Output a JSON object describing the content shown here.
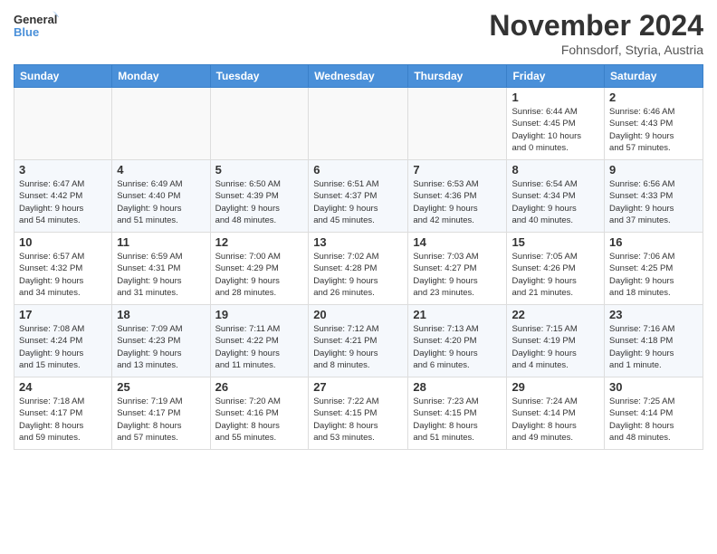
{
  "logo": {
    "line1": "General",
    "line2": "Blue"
  },
  "title": "November 2024",
  "location": "Fohnsdorf, Styria, Austria",
  "weekdays": [
    "Sunday",
    "Monday",
    "Tuesday",
    "Wednesday",
    "Thursday",
    "Friday",
    "Saturday"
  ],
  "weeks": [
    [
      {
        "day": "",
        "info": ""
      },
      {
        "day": "",
        "info": ""
      },
      {
        "day": "",
        "info": ""
      },
      {
        "day": "",
        "info": ""
      },
      {
        "day": "",
        "info": ""
      },
      {
        "day": "1",
        "info": "Sunrise: 6:44 AM\nSunset: 4:45 PM\nDaylight: 10 hours\nand 0 minutes."
      },
      {
        "day": "2",
        "info": "Sunrise: 6:46 AM\nSunset: 4:43 PM\nDaylight: 9 hours\nand 57 minutes."
      }
    ],
    [
      {
        "day": "3",
        "info": "Sunrise: 6:47 AM\nSunset: 4:42 PM\nDaylight: 9 hours\nand 54 minutes."
      },
      {
        "day": "4",
        "info": "Sunrise: 6:49 AM\nSunset: 4:40 PM\nDaylight: 9 hours\nand 51 minutes."
      },
      {
        "day": "5",
        "info": "Sunrise: 6:50 AM\nSunset: 4:39 PM\nDaylight: 9 hours\nand 48 minutes."
      },
      {
        "day": "6",
        "info": "Sunrise: 6:51 AM\nSunset: 4:37 PM\nDaylight: 9 hours\nand 45 minutes."
      },
      {
        "day": "7",
        "info": "Sunrise: 6:53 AM\nSunset: 4:36 PM\nDaylight: 9 hours\nand 42 minutes."
      },
      {
        "day": "8",
        "info": "Sunrise: 6:54 AM\nSunset: 4:34 PM\nDaylight: 9 hours\nand 40 minutes."
      },
      {
        "day": "9",
        "info": "Sunrise: 6:56 AM\nSunset: 4:33 PM\nDaylight: 9 hours\nand 37 minutes."
      }
    ],
    [
      {
        "day": "10",
        "info": "Sunrise: 6:57 AM\nSunset: 4:32 PM\nDaylight: 9 hours\nand 34 minutes."
      },
      {
        "day": "11",
        "info": "Sunrise: 6:59 AM\nSunset: 4:31 PM\nDaylight: 9 hours\nand 31 minutes."
      },
      {
        "day": "12",
        "info": "Sunrise: 7:00 AM\nSunset: 4:29 PM\nDaylight: 9 hours\nand 28 minutes."
      },
      {
        "day": "13",
        "info": "Sunrise: 7:02 AM\nSunset: 4:28 PM\nDaylight: 9 hours\nand 26 minutes."
      },
      {
        "day": "14",
        "info": "Sunrise: 7:03 AM\nSunset: 4:27 PM\nDaylight: 9 hours\nand 23 minutes."
      },
      {
        "day": "15",
        "info": "Sunrise: 7:05 AM\nSunset: 4:26 PM\nDaylight: 9 hours\nand 21 minutes."
      },
      {
        "day": "16",
        "info": "Sunrise: 7:06 AM\nSunset: 4:25 PM\nDaylight: 9 hours\nand 18 minutes."
      }
    ],
    [
      {
        "day": "17",
        "info": "Sunrise: 7:08 AM\nSunset: 4:24 PM\nDaylight: 9 hours\nand 15 minutes."
      },
      {
        "day": "18",
        "info": "Sunrise: 7:09 AM\nSunset: 4:23 PM\nDaylight: 9 hours\nand 13 minutes."
      },
      {
        "day": "19",
        "info": "Sunrise: 7:11 AM\nSunset: 4:22 PM\nDaylight: 9 hours\nand 11 minutes."
      },
      {
        "day": "20",
        "info": "Sunrise: 7:12 AM\nSunset: 4:21 PM\nDaylight: 9 hours\nand 8 minutes."
      },
      {
        "day": "21",
        "info": "Sunrise: 7:13 AM\nSunset: 4:20 PM\nDaylight: 9 hours\nand 6 minutes."
      },
      {
        "day": "22",
        "info": "Sunrise: 7:15 AM\nSunset: 4:19 PM\nDaylight: 9 hours\nand 4 minutes."
      },
      {
        "day": "23",
        "info": "Sunrise: 7:16 AM\nSunset: 4:18 PM\nDaylight: 9 hours\nand 1 minute."
      }
    ],
    [
      {
        "day": "24",
        "info": "Sunrise: 7:18 AM\nSunset: 4:17 PM\nDaylight: 8 hours\nand 59 minutes."
      },
      {
        "day": "25",
        "info": "Sunrise: 7:19 AM\nSunset: 4:17 PM\nDaylight: 8 hours\nand 57 minutes."
      },
      {
        "day": "26",
        "info": "Sunrise: 7:20 AM\nSunset: 4:16 PM\nDaylight: 8 hours\nand 55 minutes."
      },
      {
        "day": "27",
        "info": "Sunrise: 7:22 AM\nSunset: 4:15 PM\nDaylight: 8 hours\nand 53 minutes."
      },
      {
        "day": "28",
        "info": "Sunrise: 7:23 AM\nSunset: 4:15 PM\nDaylight: 8 hours\nand 51 minutes."
      },
      {
        "day": "29",
        "info": "Sunrise: 7:24 AM\nSunset: 4:14 PM\nDaylight: 8 hours\nand 49 minutes."
      },
      {
        "day": "30",
        "info": "Sunrise: 7:25 AM\nSunset: 4:14 PM\nDaylight: 8 hours\nand 48 minutes."
      }
    ]
  ]
}
